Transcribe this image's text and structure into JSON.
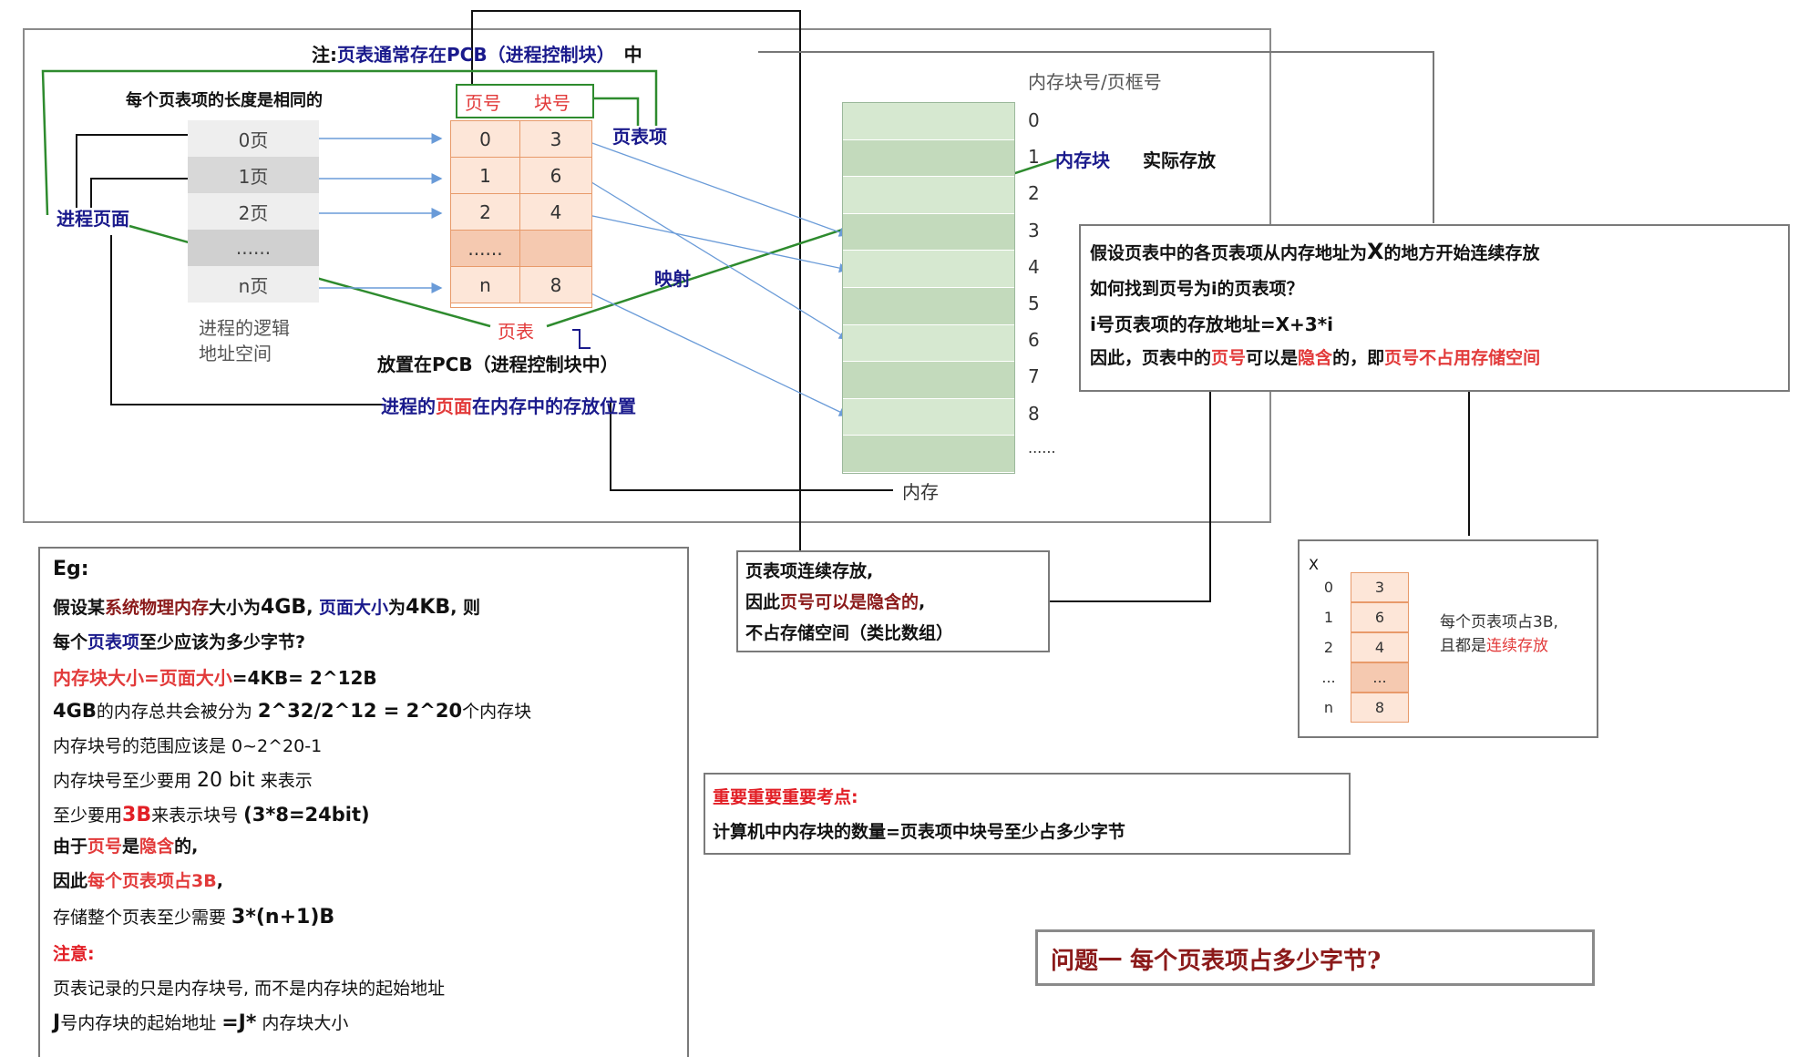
{
  "top": {
    "note_prefix": "注:",
    "note_main": "页表通常存在PCB（进程控制块）",
    "note_suffix": "中",
    "entry_same_length": "每个页表项的长度是相同的",
    "header_page_no": "页号",
    "header_block_no": "块号",
    "page_table_entry_label": "页表项",
    "process_page_label": "进程页面",
    "logical_pages": [
      "0页",
      "1页",
      "2页",
      "......",
      "n页"
    ],
    "logical_space_label_1": "进程的逻辑",
    "logical_space_label_2": "地址空间",
    "page_table_rows": [
      {
        "page": "0",
        "block": "3"
      },
      {
        "page": "1",
        "block": "6"
      },
      {
        "page": "2",
        "block": "4"
      },
      {
        "page": "......",
        "block": ""
      },
      {
        "page": "n",
        "block": "8"
      }
    ],
    "page_table_label": "页表",
    "mapping_label": "映射",
    "placed_in_pcb": "放置在PCB（进程控制块中）",
    "storage_position_1": "进程的",
    "storage_position_2": "页面",
    "storage_position_3": "在内存中的存放位置",
    "memory_block_header": "内存块号/页框号",
    "memory_block_numbers": [
      "0",
      "1",
      "2",
      "3",
      "4",
      "5",
      "6",
      "7",
      "8",
      "......"
    ],
    "memory_block_label": "内存块",
    "actual_storage": "实际存放",
    "memory_label": "内存"
  },
  "right_note": {
    "line1_a": "假设页表中的各页表项从内存地址为",
    "line1_b": "X",
    "line1_c": "的地方开始连续存放",
    "line2": "如何找到页号为i的页表项？",
    "line3": "i号页表项的存放地址=X+3*i",
    "line4_a": "因此，页表中的",
    "line4_b": "页号",
    "line4_c": "可以是",
    "line4_d": "隐含",
    "line4_e": "的，即",
    "line4_f": "页号不占用存储空间"
  },
  "mini_table": {
    "x_label": "X",
    "pages": [
      "0",
      "1",
      "2",
      "...",
      "n"
    ],
    "blocks": [
      "3",
      "6",
      "4",
      "...",
      "8"
    ],
    "note_1": "每个页表项占3B,",
    "note_2a": "且都是",
    "note_2b": "连续存放"
  },
  "middle_note": {
    "line1": "页表项连续存放,",
    "line2_a": "因此",
    "line2_b": "页号可以是隐含的",
    "line2_c": ",",
    "line3": "不占存储空间（类比数组）"
  },
  "key_point": {
    "title": "重要重要重要考点:",
    "body": "计算机中内存块的数量=页表项中块号至少占多少字节"
  },
  "question": "问题一  每个页表项占多少字节?",
  "example": {
    "title": "Eg:",
    "l1_a": "假设某",
    "l1_b": "系统物理内存",
    "l1_c": "大小为",
    "l1_d": "4GB",
    "l1_e": ", ",
    "l1_f": "页面大小",
    "l1_g": "为",
    "l1_h": "4KB",
    "l1_i": ", 则",
    "l2_a": "每个",
    "l2_b": "页表项",
    "l2_c": "至少应该为多少字节?",
    "l3_a": "内存块大小=页面大小",
    "l3_b": "=4KB= 2^12B",
    "l4_a": "4GB",
    "l4_b": "的内存总共会被分为 ",
    "l4_c": "2^32/2^12 = 2^20",
    "l4_d": "个内存块",
    "l5": "内存块号的范围应该是 0~2^20-1",
    "l6_a": "内存块号至少要用 ",
    "l6_b": "20 bit",
    "l6_c": " 来表示",
    "l7_a": "至少要用",
    "l7_b": "3B",
    "l7_c": "来表示块号 ",
    "l7_d": "(3*8=24bit)",
    "l8_a": "由于",
    "l8_b": "页号",
    "l8_c": "是",
    "l8_d": "隐含",
    "l8_e": "的,",
    "l9_a": "因此",
    "l9_b": "每个页表项占3B",
    "l9_c": ",",
    "l10_a": "存储整个页表至少需要 ",
    "l10_b": "3*(n+1)B",
    "l11": "注意:",
    "l12": "页表记录的只是内存块号, 而不是内存块的起始地址",
    "l13_a": "J",
    "l13_b": "号内存块的起始地址 ",
    "l13_c": "=J*",
    "l13_d": " 内存块大小"
  }
}
